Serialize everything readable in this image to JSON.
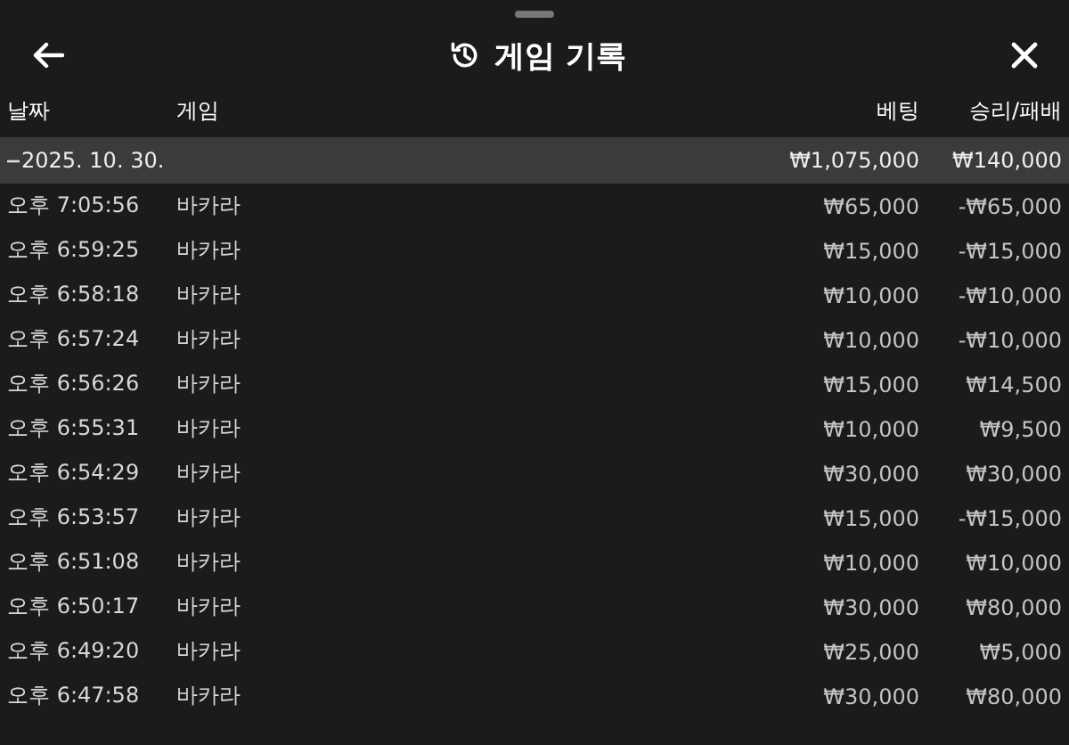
{
  "title": "게임 기록",
  "columns": [
    "날짜",
    "게임",
    "베팅",
    "승리/패배"
  ],
  "group": {
    "date": "2025. 10. 30.",
    "expanded": true,
    "bet": "₩1,075,000",
    "result": "₩140,000"
  },
  "rows": [
    {
      "time": "오후 7:05:56",
      "game": "바카라",
      "bet": "₩65,000",
      "result": "-₩65,000"
    },
    {
      "time": "오후 6:59:25",
      "game": "바카라",
      "bet": "₩15,000",
      "result": "-₩15,000"
    },
    {
      "time": "오후 6:58:18",
      "game": "바카라",
      "bet": "₩10,000",
      "result": "-₩10,000"
    },
    {
      "time": "오후 6:57:24",
      "game": "바카라",
      "bet": "₩10,000",
      "result": "-₩10,000"
    },
    {
      "time": "오후 6:56:26",
      "game": "바카라",
      "bet": "₩15,000",
      "result": "₩14,500"
    },
    {
      "time": "오후 6:55:31",
      "game": "바카라",
      "bet": "₩10,000",
      "result": "₩9,500"
    },
    {
      "time": "오후 6:54:29",
      "game": "바카라",
      "bet": "₩30,000",
      "result": "₩30,000"
    },
    {
      "time": "오후 6:53:57",
      "game": "바카라",
      "bet": "₩15,000",
      "result": "-₩15,000"
    },
    {
      "time": "오후 6:51:08",
      "game": "바카라",
      "bet": "₩10,000",
      "result": "₩10,000"
    },
    {
      "time": "오후 6:50:17",
      "game": "바카라",
      "bet": "₩30,000",
      "result": "₩80,000"
    },
    {
      "time": "오후 6:49:20",
      "game": "바카라",
      "bet": "₩25,000",
      "result": "₩5,000"
    },
    {
      "time": "오후 6:47:58",
      "game": "바카라",
      "bet": "₩30,000",
      "result": "₩80,000"
    }
  ]
}
